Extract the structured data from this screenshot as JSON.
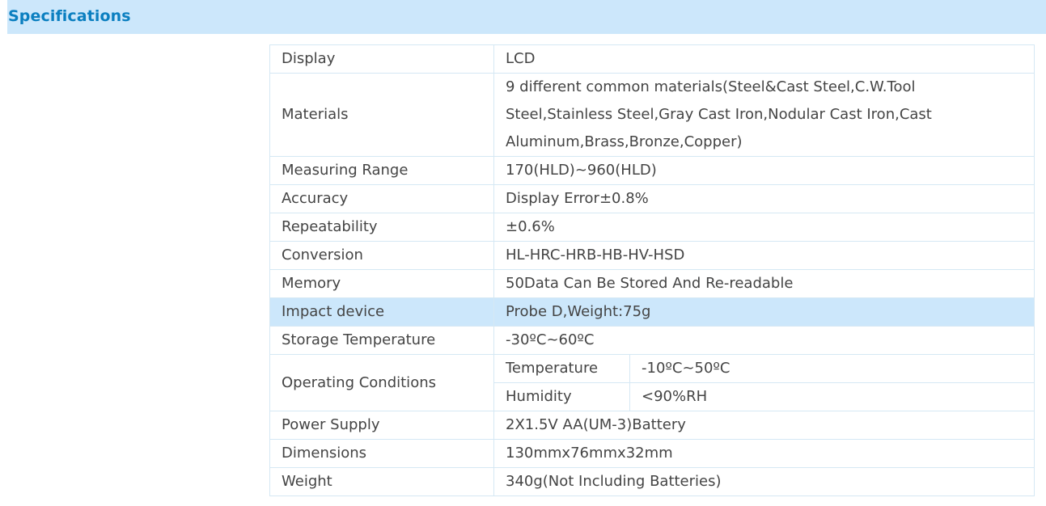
{
  "header": {
    "title": "Specifications"
  },
  "specs": {
    "display": {
      "label": "Display",
      "value": "LCD"
    },
    "materials": {
      "label": "Materials",
      "value": "9 different common materials(Steel&Cast Steel,C.W.Tool Steel,Stainless Steel,Gray Cast Iron,Nodular Cast Iron,Cast Aluminum,Brass,Bronze,Copper)"
    },
    "measuring_range": {
      "label": "Measuring Range",
      "value": "170(HLD)~960(HLD)"
    },
    "accuracy": {
      "label": "Accuracy",
      "value": "Display Error±0.8%"
    },
    "repeatability": {
      "label": "Repeatability",
      "value": "±0.6%"
    },
    "conversion": {
      "label": "Conversion",
      "value": "HL-HRC-HRB-HB-HV-HSD"
    },
    "memory": {
      "label": "Memory",
      "value": "50Data Can Be Stored And Re-readable"
    },
    "impact_device": {
      "label": "Impact device",
      "value": "Probe D,Weight:75g"
    },
    "storage_temperature": {
      "label": "Storage Temperature",
      "value": "-30ºC~60ºC"
    },
    "operating_conditions": {
      "label": "Operating Conditions",
      "temperature": {
        "label": "Temperature",
        "value": "-10ºC~50ºC"
      },
      "humidity": {
        "label": "Humidity",
        "value": "<90%RH"
      }
    },
    "power_supply": {
      "label": "Power Supply",
      "value": "2X1.5V AA(UM-3)Battery"
    },
    "dimensions": {
      "label": "Dimensions",
      "value": "130mmx76mmx32mm"
    },
    "weight": {
      "label": "Weight",
      "value": "340g(Not Including Batteries)"
    }
  },
  "colors": {
    "header_background": "#cce7fb",
    "header_text": "#0b7fc0",
    "highlight_row": "#cce7fb",
    "border": "#d5e8f4",
    "text": "#444444"
  }
}
